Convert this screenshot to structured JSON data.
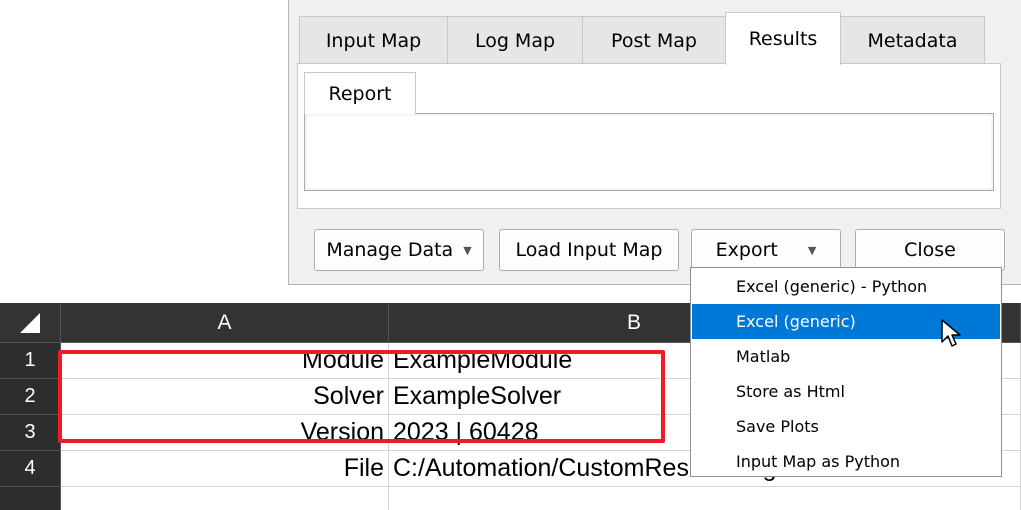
{
  "dialog": {
    "tabs": [
      "Input Map",
      "Log Map",
      "Post Map",
      "Results",
      "Metadata"
    ],
    "active_tab": "Results",
    "sub_tab": "Report",
    "buttons": {
      "manage_data": "Manage Data",
      "load_input_map": "Load Input Map",
      "export": "Export",
      "close": "Close"
    }
  },
  "export_menu": {
    "items": [
      "Excel (generic) - Python",
      "Excel (generic)",
      "Matlab",
      "Store as Html",
      "Save Plots",
      "Input Map as Python"
    ],
    "selected": "Excel (generic)"
  },
  "sheet": {
    "columns": [
      "A",
      "B"
    ],
    "rows": [
      {
        "num": "1",
        "a": "Module",
        "b": "ExampleModule"
      },
      {
        "num": "2",
        "a": "Solver",
        "b": "ExampleSolver"
      },
      {
        "num": "3",
        "a": "Version",
        "b": "2023 | 60428"
      },
      {
        "num": "4",
        "a": "File",
        "b": "C:/Automation/CustomResultFile.gdr"
      }
    ]
  },
  "colors": {
    "highlight": "#ee1c25",
    "menu_selection": "#0078d7",
    "header_bg": "#333333"
  }
}
